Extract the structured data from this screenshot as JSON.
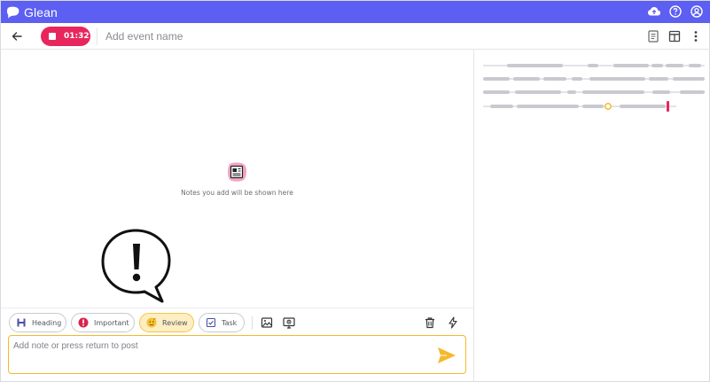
{
  "app": {
    "brand": "Glean",
    "accent": "#5c5ff2",
    "record_color": "#e8265e",
    "highlight_color": "#f5b82e"
  },
  "header": {
    "record_time": "01:32",
    "event_placeholder": "Add event name"
  },
  "notes": {
    "empty_text": "Notes you add will be shown here"
  },
  "toolbar": {
    "chips": {
      "heading": "Heading",
      "important": "Important",
      "review": "Review",
      "task": "Task"
    }
  },
  "composer": {
    "placeholder": "Add note or press return to post"
  },
  "icons": {
    "topbar": [
      "cloud-upload-icon",
      "help-icon",
      "account-icon"
    ],
    "header": [
      "notes-view-icon",
      "layout-icon",
      "more-vertical-icon"
    ],
    "toolbar": [
      "image-icon",
      "screen-capture-icon",
      "delete-icon",
      "flash-icon"
    ]
  }
}
